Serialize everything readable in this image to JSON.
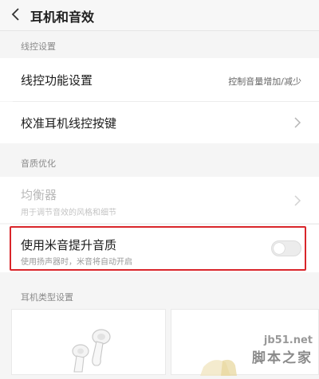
{
  "header": {
    "title": "耳机和音效",
    "back_icon": "chevron-left-icon"
  },
  "sections": {
    "wire_control": {
      "header": "线控设置",
      "function_setting": {
        "label": "线控功能设置",
        "value": "控制音量增加/减少"
      },
      "calibrate": {
        "label": "校准耳机线控按键"
      }
    },
    "sound_optimization": {
      "header": "音质优化",
      "equalizer": {
        "label": "均衡器",
        "description": "用于调节音效的风格和细节",
        "enabled": false
      },
      "mi_sound": {
        "label": "使用米音提升音质",
        "description": "使用扬声器时，米音将自动开启",
        "toggle_on": false
      }
    },
    "earphone_type": {
      "header": "耳机类型设置"
    }
  },
  "watermark": {
    "url": "jb51.net",
    "text": "脚本之家"
  },
  "colors": {
    "highlight_border": "#d9252a",
    "background": "#f5f5f5",
    "row_background": "#ffffff"
  }
}
